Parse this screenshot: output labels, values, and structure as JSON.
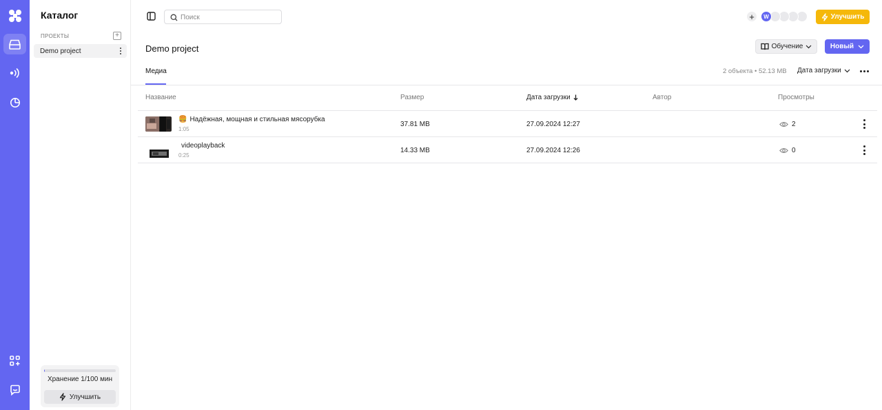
{
  "rail": {
    "logo_icon": "grid-logo-icon",
    "items": [
      {
        "icon": "catalog-icon",
        "active": true
      },
      {
        "icon": "broadcast-icon",
        "active": false
      },
      {
        "icon": "analytics-icon",
        "active": false
      },
      {
        "icon": "apps-add-icon",
        "active": false
      },
      {
        "icon": "chat-support-icon",
        "active": false
      }
    ]
  },
  "sidebar": {
    "title": "Каталог",
    "section_label": "ПРОЕКТЫ",
    "projects": [
      {
        "label": "Demo project",
        "selected": true
      }
    ],
    "storage": {
      "label": "Хранение 1/100 мин",
      "used_fraction": 0.01,
      "upgrade_label": "Улучшить"
    }
  },
  "topbar": {
    "search_placeholder": "Поиск",
    "avatar_initial": "W",
    "upgrade_label": "Улучшить"
  },
  "header": {
    "title": "Demo project",
    "learn_label": "Обучение",
    "new_label": "Новый"
  },
  "tabs": {
    "media_label": "Медиа",
    "summary": "2 объекта • 52.13 MB",
    "sort_label": "Дата загрузки"
  },
  "table": {
    "columns": {
      "name": "Название",
      "size": "Размер",
      "date": "Дата загрузки",
      "author": "Автор",
      "views": "Просмотры"
    },
    "rows": [
      {
        "emoji": "🍔",
        "title": "Надёжная, мощная и стильная мясорубка",
        "duration": "1:05",
        "size": "37.81 MB",
        "date": "27.09.2024 12:27",
        "author": "",
        "views": "2"
      },
      {
        "emoji": "",
        "title": "videoplayback",
        "duration": "0:25",
        "size": "14.33 MB",
        "date": "27.09.2024 12:26",
        "author": "",
        "views": "0"
      }
    ]
  },
  "colors": {
    "accent": "#6366f1",
    "upgrade": "#f5b80a"
  }
}
